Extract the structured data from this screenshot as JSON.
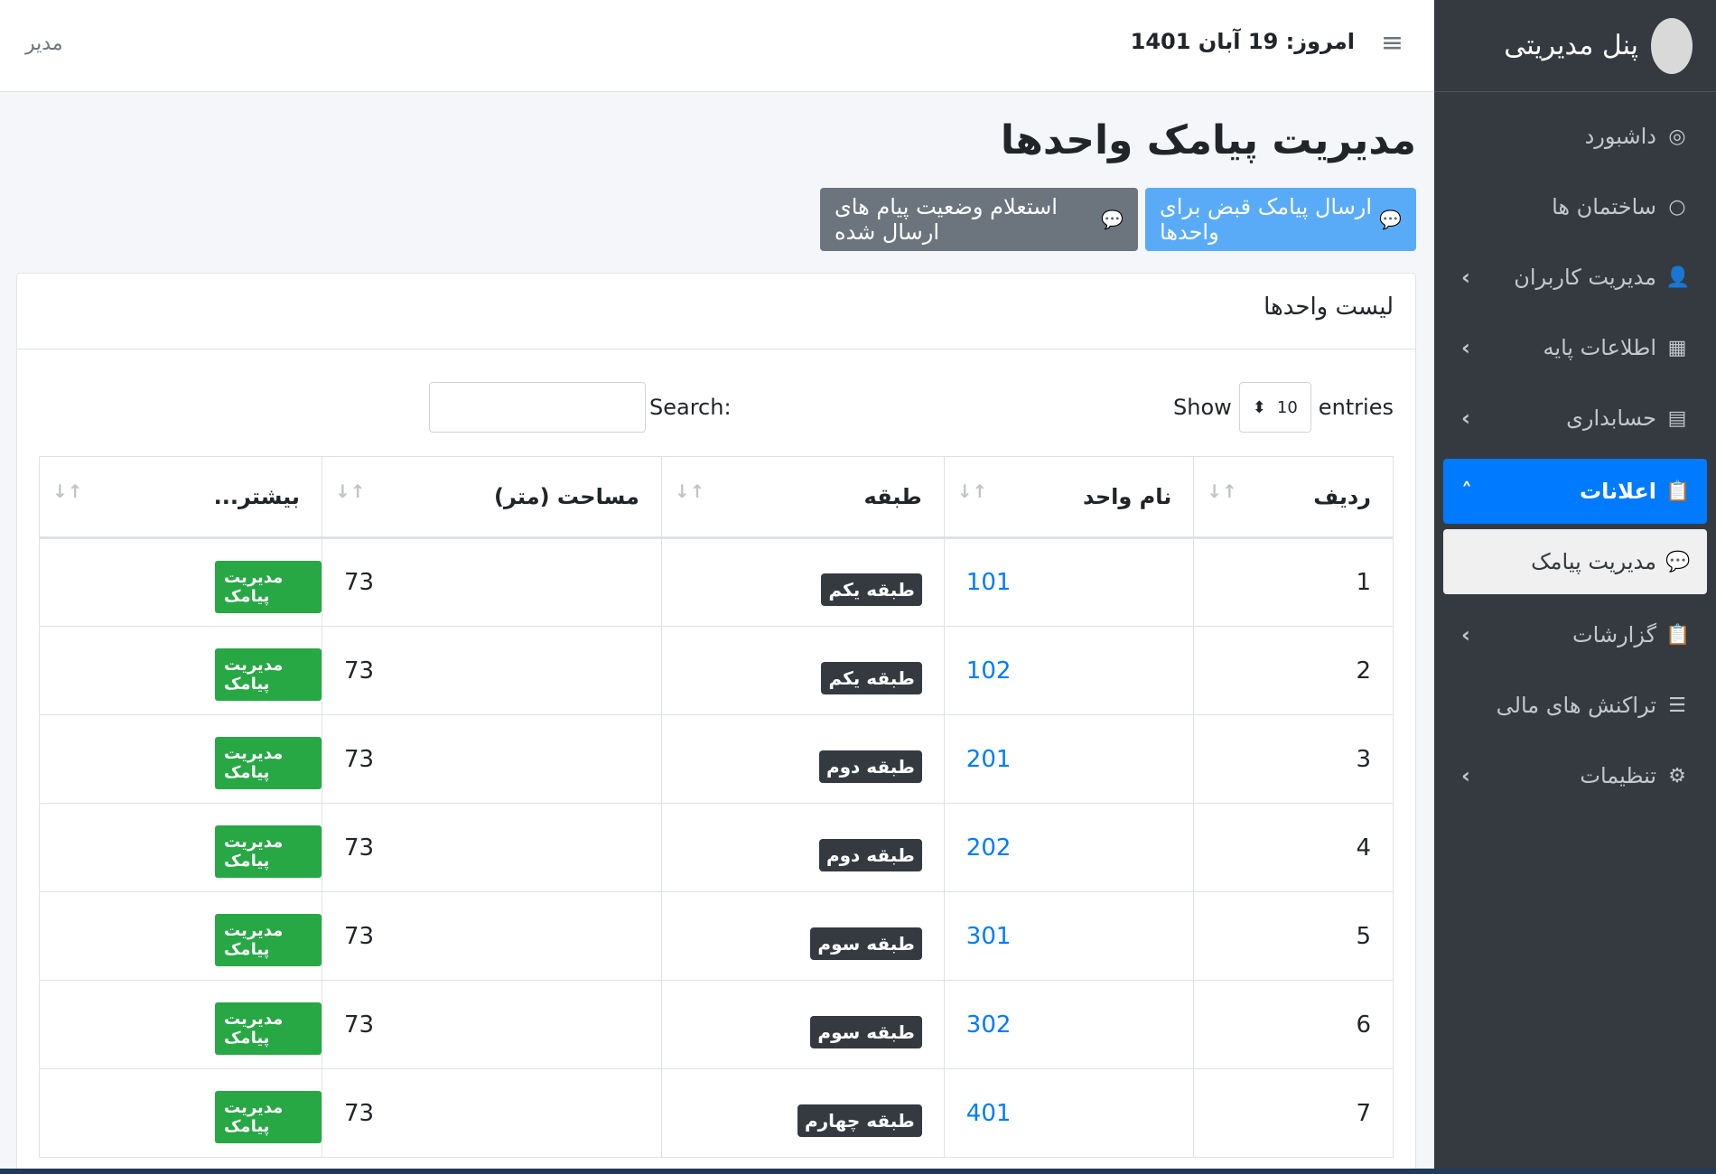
{
  "sidebar": {
    "brand": "پنل مدیریتی",
    "items": [
      {
        "label": "داشبورد",
        "icon": "◎",
        "has_caret": false
      },
      {
        "label": "ساختمان ها",
        "icon": "○",
        "has_caret": false
      },
      {
        "label": "مدیریت کاربران",
        "icon": "👤",
        "has_caret": true
      },
      {
        "label": "اطلاعات پایه",
        "icon": "▦",
        "has_caret": true
      },
      {
        "label": "حسابداری",
        "icon": "▤",
        "has_caret": true
      }
    ],
    "active": {
      "label": "اعلانات",
      "icon": "📋"
    },
    "sub": {
      "label": "مدیریت پیامک",
      "icon": "💬"
    },
    "items_after": [
      {
        "label": "گزارشات",
        "icon": "📋",
        "has_caret": true
      },
      {
        "label": "تراکنش های مالی",
        "icon": "☰",
        "has_caret": false
      },
      {
        "label": "تنظیمات",
        "icon": "⚙",
        "has_caret": true
      }
    ]
  },
  "topbar": {
    "today": "امروز: 19 آبان 1401",
    "user": "مدیر"
  },
  "page": {
    "title": "مدیریت پیامک واحدها",
    "btn_send": "ارسال پیامک قبض برای واحدها",
    "btn_status": "استعلام وضعیت پیام های ارسال شده"
  },
  "card": {
    "title": "لیست واحدها",
    "show_label": "Show",
    "entries_value": "10",
    "entries_label": "entries",
    "search_label": "Search:"
  },
  "table": {
    "headers": [
      "ردیف",
      "نام واحد",
      "طبقه",
      "مساحت (متر)",
      "بیشتر..."
    ],
    "rows": [
      {
        "row": "1",
        "unit": "101",
        "floor": "طبقه یکم",
        "area": "73",
        "action": "مدیریت پیامک"
      },
      {
        "row": "2",
        "unit": "102",
        "floor": "طبقه یکم",
        "area": "73",
        "action": "مدیریت پیامک"
      },
      {
        "row": "3",
        "unit": "201",
        "floor": "طبقه دوم",
        "area": "73",
        "action": "مدیریت پیامک"
      },
      {
        "row": "4",
        "unit": "202",
        "floor": "طبقه دوم",
        "area": "73",
        "action": "مدیریت پیامک"
      },
      {
        "row": "5",
        "unit": "301",
        "floor": "طبقه سوم",
        "area": "73",
        "action": "مدیریت پیامک"
      },
      {
        "row": "6",
        "unit": "302",
        "floor": "طبقه سوم",
        "area": "73",
        "action": "مدیریت پیامک"
      },
      {
        "row": "7",
        "unit": "401",
        "floor": "طبقه چهارم",
        "area": "73",
        "action": "مدیریت پیامک"
      }
    ]
  }
}
